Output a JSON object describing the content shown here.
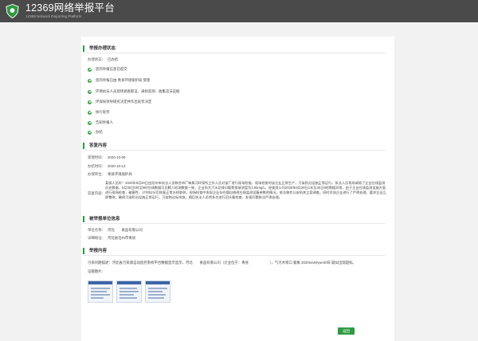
{
  "header": {
    "title": "12369网络举报平台",
    "subtitle": "12369 Network Reporting Platform"
  },
  "status_section": {
    "heading": "举报办理状态",
    "status_label": "办理状态：",
    "status_value": "已办结",
    "steps": [
      "您的举报信息已提交",
      "您的举报已由 青县环境保护局 受理",
      "环境执法人员现场调查取证、采样监测、收集违法证据",
      "环保局领导研究决定并作出处罚决定",
      "执行处罚",
      "告知举报人",
      "办结"
    ]
  },
  "reply_section": {
    "heading": "答复内容",
    "accept_label": "受理时间：",
    "accept_value": "2020-10-09",
    "finish_label": "办结时间：",
    "finish_value": "2020-10-13",
    "unit_label": "办理单位：",
    "unit_value": "青县环境保护局",
    "reply_label": "答复内容：",
    "reply_text": "某接人员好！2020年9月30日由沧州市执法人员联合市厂睐臭河环保所工作人员对该厂进行现场检查，现场检查时该企业正常生产，污染防治设施正常运行，执法人员现场调阅了企业在线监测历史数据，9月30日0时至9时在线数据可见颗人检测数据一致，企业尚大污水总排口氨氮排放浓度为3.65mg/L，经查其公司2020年9月29日1年至30日9时数据异常，由于企业在线监测设施方面进行现场检查，破塞性，17时52分后恢复正常水样取样，现场检查中发现企业存在擅自修改在线监测设备参数的情况，依法移交公安机关立案调查。同时对该企业进行了严肃处理，要求企业立即整改，确保污染防治设施正常运行，污染物达标排放。随后执法人员将多次进行回头看检查，发现问题依法严肃处理。"
  },
  "reported_section": {
    "heading": "被举报单位信息",
    "name_label": "单位名称：",
    "name_value": "河北　　食品有限公司",
    "address_label": "详细地址：",
    "address_value": "河北省沧州市青县"
  },
  "report_section": {
    "heading": "举报内容",
    "problem_label": "污染问题描述：",
    "problem_text": "河北省污染源自动监控系统平台数据显示显示，河北　　食品有限公司（企业位于：青县　　　　　　），气污水排口 氨氮 2020nian9yue30日 疑似出现超标。",
    "evidence_label": "证据图片："
  },
  "footer": {
    "return_label": "返回"
  },
  "colors": {
    "brand_green": "#2e9a41",
    "header_bg": "#4a4a4a"
  }
}
